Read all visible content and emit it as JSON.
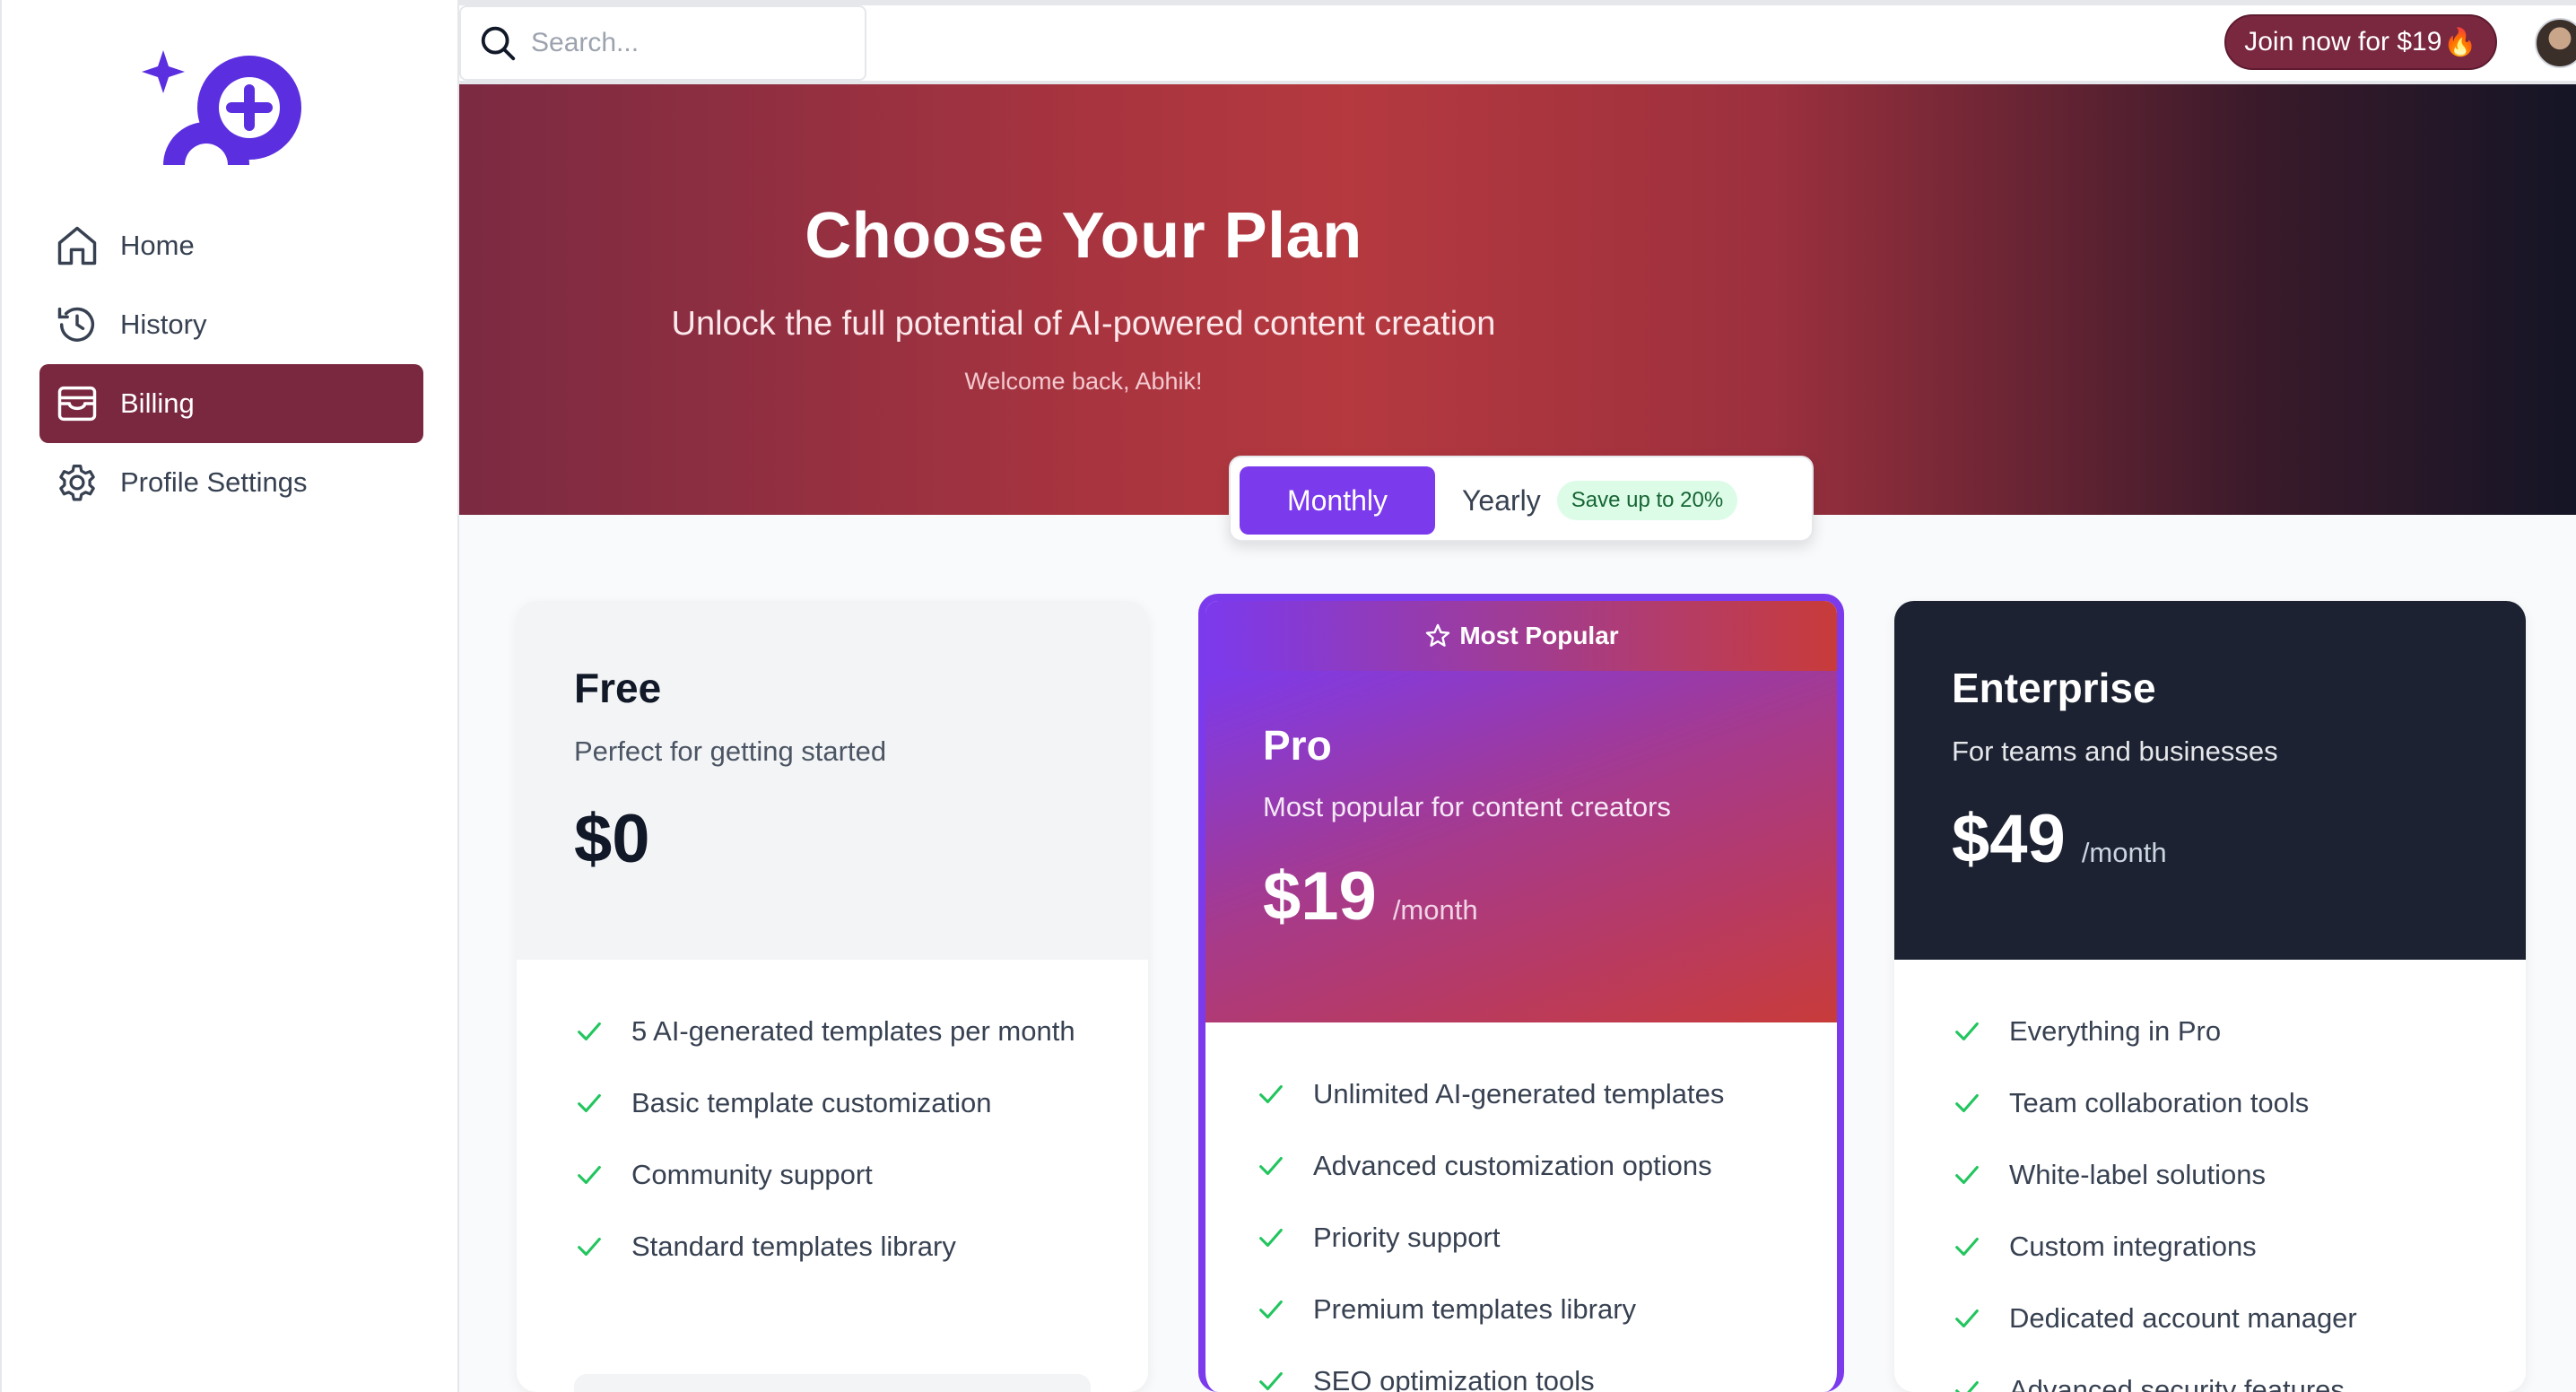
{
  "header": {
    "search_placeholder": "Search...",
    "join_label": "Join now for $19",
    "join_emoji": "🔥"
  },
  "sidebar": {
    "items": [
      {
        "label": "Home",
        "icon": "home-icon",
        "active": false
      },
      {
        "label": "History",
        "icon": "history-icon",
        "active": false
      },
      {
        "label": "Billing",
        "icon": "wallet-icon",
        "active": true
      },
      {
        "label": "Profile Settings",
        "icon": "gear-icon",
        "active": false
      }
    ]
  },
  "hero": {
    "title": "Choose Your Plan",
    "subtitle": "Unlock the full potential of AI-powered content creation",
    "welcome": "Welcome back, Abhik!"
  },
  "billing_toggle": {
    "monthly": "Monthly",
    "yearly": "Yearly",
    "badge": "Save up to 20%",
    "selected": "Monthly"
  },
  "plans": {
    "free": {
      "name": "Free",
      "description": "Perfect for getting started",
      "price": "$0",
      "features": [
        "5 AI-generated templates per month",
        "Basic template customization",
        "Community support",
        "Standard templates library"
      ]
    },
    "pro": {
      "badge": "Most Popular",
      "name": "Pro",
      "description": "Most popular for content creators",
      "price": "$19",
      "unit": "/month",
      "features": [
        "Unlimited AI-generated templates",
        "Advanced customization options",
        "Priority support",
        "Premium templates library",
        "SEO optimization tools"
      ]
    },
    "enterprise": {
      "name": "Enterprise",
      "description": "For teams and businesses",
      "price": "$49",
      "unit": "/month",
      "features": [
        "Everything in Pro",
        "Team collaboration tools",
        "White-label solutions",
        "Custom integrations",
        "Dedicated account manager",
        "Advanced security features"
      ]
    }
  },
  "colors": {
    "brand": "#7a2740",
    "accent": "#7c3aed",
    "check": "#22c55e",
    "enterprise_bg": "#1c2231"
  }
}
